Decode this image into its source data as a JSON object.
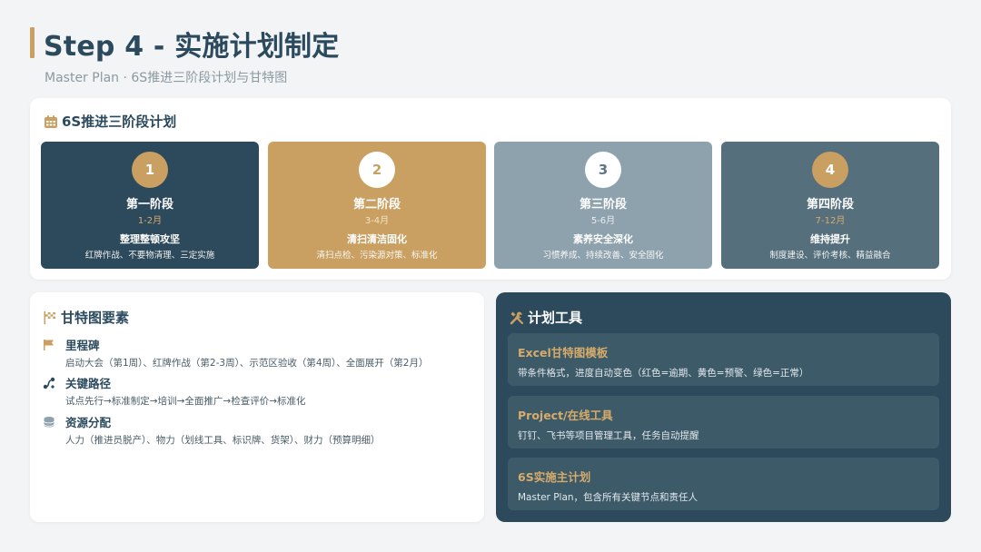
{
  "header": {
    "title": "Step 4 - 实施计划制定",
    "subtitle": "Master Plan · 6S推进三阶段计划与甘特图"
  },
  "stages_section": {
    "heading": "6S推进三阶段计划",
    "icon": "calendar-icon",
    "stages": [
      {
        "num": "1",
        "name": "第一阶段",
        "period": "1-2月",
        "focus": "整理整顿攻坚",
        "detail": "红牌作战、不要物清理、三定实施",
        "bg": "#2c4a5b",
        "circle_bg": "#c9a062",
        "circle_fg": "#ffffff",
        "period_color": "#d7ab6a"
      },
      {
        "num": "2",
        "name": "第二阶段",
        "period": "3-4月",
        "focus": "清扫清洁固化",
        "detail": "清扫点检、污染源对策、标准化",
        "bg": "#c9a062",
        "circle_bg": "#ffffff",
        "circle_fg": "#c9a062",
        "period_color": "#f3e2c6"
      },
      {
        "num": "3",
        "name": "第三阶段",
        "period": "5-6月",
        "focus": "素养安全深化",
        "detail": "习惯养成、持续改善、安全固化",
        "bg": "#8ea2ad",
        "circle_bg": "#ffffff",
        "circle_fg": "#5e7785",
        "period_color": "#e6edf1"
      },
      {
        "num": "4",
        "name": "第四阶段",
        "period": "7-12月",
        "focus": "维持提升",
        "detail": "制度建设、评价考核、精益融合",
        "bg": "#556f7c",
        "circle_bg": "#c9a062",
        "circle_fg": "#ffffff",
        "period_color": "#d7ab6a"
      }
    ]
  },
  "gantt_section": {
    "heading": "甘特图要素",
    "icon": "checkered-flag-icon",
    "items": [
      {
        "title": "里程碑",
        "icon": "flag-icon",
        "desc": "启动大会（第1周）、红牌作战（第2-3周）、示范区验收（第4周）、全面展开（第2月）"
      },
      {
        "title": "关键路径",
        "icon": "route-icon",
        "desc": "试点先行→标准制定→培训→全面推广→检查评价→标准化"
      },
      {
        "title": "资源分配",
        "icon": "coins-icon",
        "desc": "人力（推进员脱产）、物力（划线工具、标识牌、货架）、财力（预算明细）"
      }
    ]
  },
  "tools_section": {
    "heading": "计划工具",
    "icon": "tools-icon",
    "tools": [
      {
        "name": "Excel甘特图模板",
        "desc": "带条件格式，进度自动变色（红色=逾期、黄色=预警、绿色=正常）"
      },
      {
        "name": "Project/在线工具",
        "desc": "钉钉、飞书等项目管理工具，任务自动提醒"
      },
      {
        "name": "6S实施主计划",
        "desc": "Master Plan，包含所有关键节点和责任人"
      }
    ]
  },
  "colors": {
    "accent_gold": "#c9a062",
    "navy": "#2c4a5b",
    "slate": "#556f7c",
    "grey_blue": "#8ea2ad",
    "background": "#f2f4f6"
  }
}
